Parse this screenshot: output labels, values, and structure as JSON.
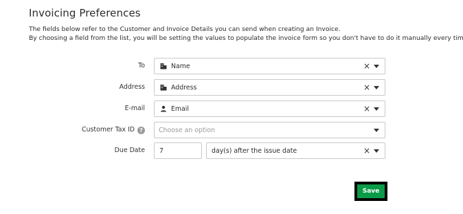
{
  "page": {
    "title": "Invoicing Preferences",
    "description_line1": "The fields below refer to the Customer and Invoice Details you can send when creating an Invoice.",
    "description_line2": "By choosing a field from the list, you will be setting the values to populate the invoice form so you don't have to do it manually every time."
  },
  "form": {
    "to": {
      "label": "To",
      "value": "Name",
      "icon": "building-icon"
    },
    "address": {
      "label": "Address",
      "value": "Address",
      "icon": "building-icon"
    },
    "email": {
      "label": "E-mail",
      "value": "Email",
      "icon": "person-icon"
    },
    "tax_id": {
      "label": "Customer Tax ID",
      "placeholder": "Choose an option",
      "help_icon": "?"
    },
    "due_date": {
      "label": "Due Date",
      "days": "7",
      "period": "day(s) after the issue date"
    }
  },
  "actions": {
    "save_label": "Save",
    "save_color": "#0a9b48"
  },
  "icons": {
    "clear": "×"
  }
}
